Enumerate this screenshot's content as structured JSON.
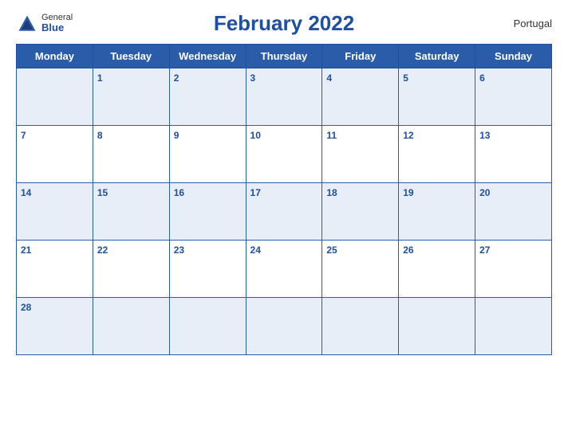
{
  "header": {
    "title": "February 2022",
    "country": "Portugal",
    "logo": {
      "general": "General",
      "blue": "Blue"
    }
  },
  "weekdays": [
    "Monday",
    "Tuesday",
    "Wednesday",
    "Thursday",
    "Friday",
    "Saturday",
    "Sunday"
  ],
  "weeks": [
    [
      "",
      "1",
      "2",
      "3",
      "4",
      "5",
      "6"
    ],
    [
      "7",
      "8",
      "9",
      "10",
      "11",
      "12",
      "13"
    ],
    [
      "14",
      "15",
      "16",
      "17",
      "18",
      "19",
      "20"
    ],
    [
      "21",
      "22",
      "23",
      "24",
      "25",
      "26",
      "27"
    ],
    [
      "28",
      "",
      "",
      "",
      "",
      "",
      ""
    ]
  ]
}
